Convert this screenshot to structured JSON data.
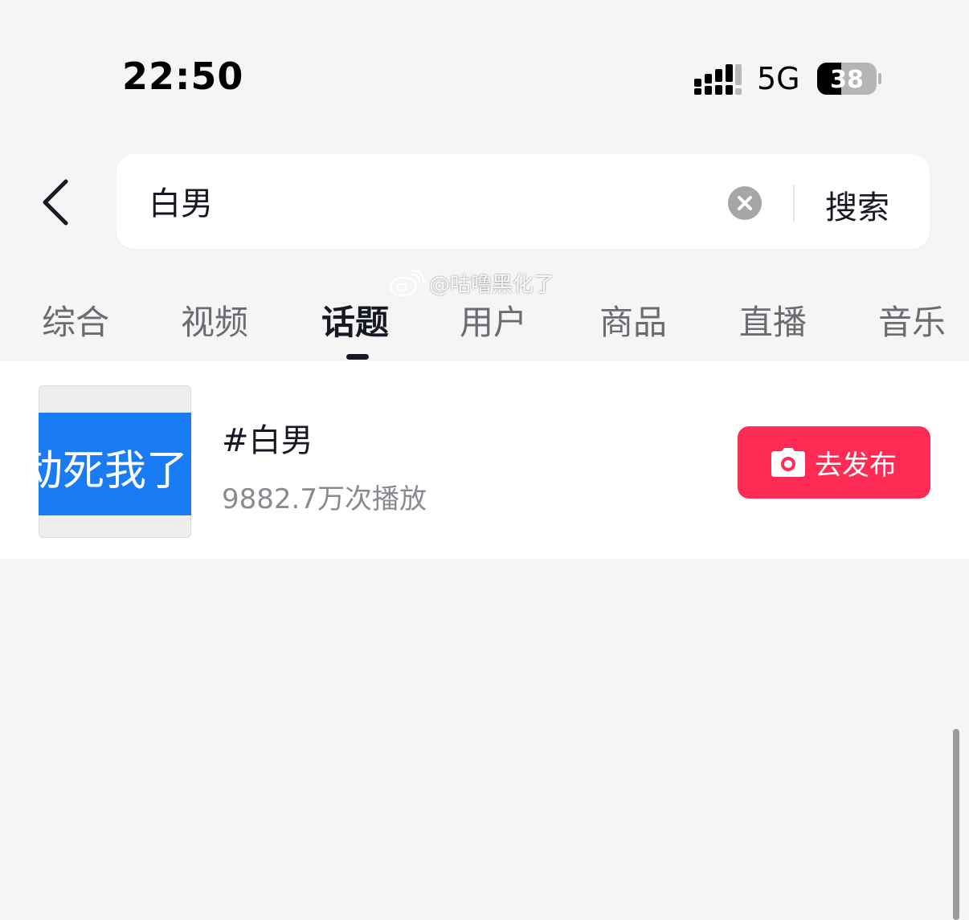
{
  "status_bar": {
    "time": "22:50",
    "network": "5G",
    "battery_level": "38",
    "signal_icon": "signal-bars-icon",
    "battery_icon": "battery-icon"
  },
  "search": {
    "query": "白男",
    "submit_label": "搜索",
    "back_icon": "chevron-left-icon",
    "clear_icon": "clear-circle-icon"
  },
  "tabs": [
    {
      "label": "综合",
      "active": false
    },
    {
      "label": "视频",
      "active": false
    },
    {
      "label": "话题",
      "active": true
    },
    {
      "label": "用户",
      "active": false
    },
    {
      "label": "商品",
      "active": false
    },
    {
      "label": "直播",
      "active": false
    },
    {
      "label": "音乐",
      "active": false
    }
  ],
  "watermark": {
    "text": "@咕噜黑化了",
    "icon": "weibo-logo-icon"
  },
  "results": [
    {
      "thumbnail_text": "动死我了",
      "title": "#白男",
      "views": "9882.7万次播放",
      "action_label": "去发布",
      "action_icon": "camera-icon"
    }
  ],
  "colors": {
    "accent": "#fe2c55",
    "background": "#f5f5f5",
    "thumbnail_band": "#1a7cf5",
    "text_primary": "#161823",
    "text_secondary": "#8a8b91"
  }
}
